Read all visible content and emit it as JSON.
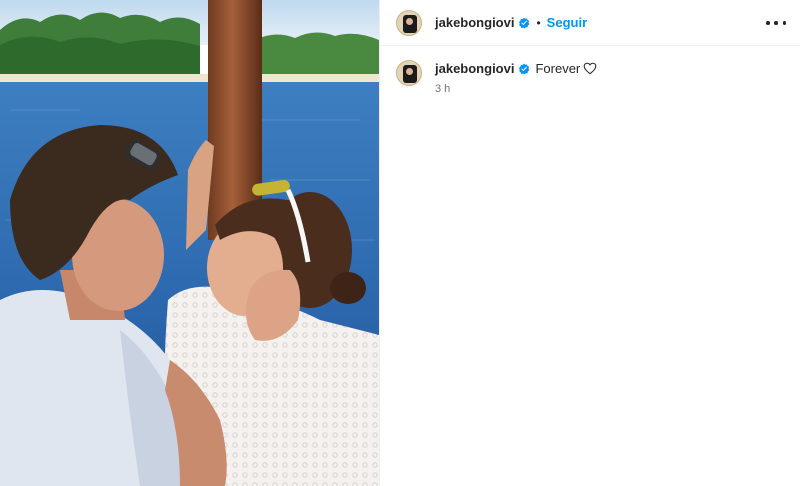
{
  "post": {
    "author": {
      "username": "jakebongiovi",
      "verified_icon": "verified-badge-icon",
      "separator": "•",
      "follow_label": "Seguir"
    },
    "caption": {
      "username": "jakebongiovi",
      "text": "Forever",
      "emoji_icon": "white-heart-icon",
      "time": "3 h"
    },
    "menu_icon": "more-options-icon"
  },
  "colors": {
    "link_blue": "#0095f6",
    "verified_blue": "#0095f6",
    "text": "#262626",
    "muted": "#737373",
    "divider": "#efefef"
  }
}
